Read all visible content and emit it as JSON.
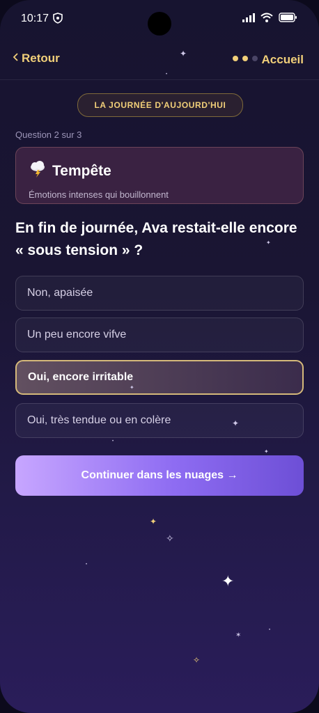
{
  "status_bar": {
    "time": "10:17"
  },
  "nav": {
    "back_label": "Retour",
    "home_label": "Accueil"
  },
  "badge": "LA JOURNÉE D'AUJOURD'HUI",
  "progress": "Question 2 sur 3",
  "weather_card": {
    "emoji": "⛈",
    "title": "Tempête",
    "subtitle": "Émotions intenses qui bouillonnent"
  },
  "question": "En fin de journée, Ava restait-elle encore « sous tension » ?",
  "options": [
    {
      "label": "Non, apaisée",
      "selected": false
    },
    {
      "label": "Un peu encore vifve",
      "selected": false
    },
    {
      "label": "Oui, encore irritable",
      "selected": true
    },
    {
      "label": "Oui, très tendue ou en colère",
      "selected": false
    }
  ],
  "cta_label": "Continuer dans les nuages →",
  "colors": {
    "accent_gold": "#f1cf79",
    "cta_start": "#c7a6ff",
    "cta_end": "#6d4fd6",
    "card_bg": "#3a2242"
  }
}
